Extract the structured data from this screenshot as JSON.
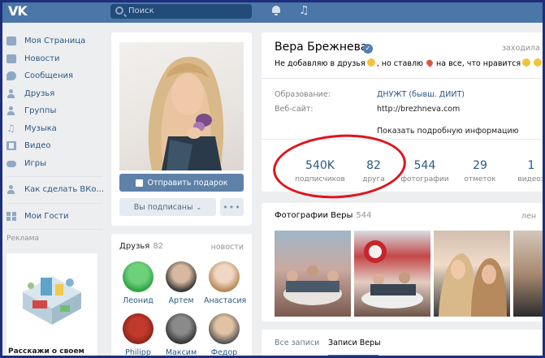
{
  "header": {
    "logo": "VK",
    "search_placeholder": "Поиск"
  },
  "menu": {
    "items": [
      {
        "label": "Моя Страница",
        "icon": "home-icon"
      },
      {
        "label": "Новости",
        "icon": "news-icon"
      },
      {
        "label": "Сообщения",
        "icon": "messages-icon"
      },
      {
        "label": "Друзья",
        "icon": "friends-icon"
      },
      {
        "label": "Группы",
        "icon": "groups-icon"
      },
      {
        "label": "Музыка",
        "icon": "music-icon"
      },
      {
        "label": "Видео",
        "icon": "video-icon"
      },
      {
        "label": "Игры",
        "icon": "games-icon"
      },
      {
        "label": "Как сделать ВКо...",
        "icon": "app-icon"
      },
      {
        "label": "Мои Гости",
        "icon": "guests-icon"
      }
    ],
    "ads_title": "Реклама",
    "ad_text": "Расскажи о своем"
  },
  "profile": {
    "gift_button": "Отправить подарок",
    "subscribed_button": "Вы подписаны",
    "more_button": "•••"
  },
  "friends": {
    "title": "Друзья",
    "count": "82",
    "new_label": "новости",
    "list": [
      {
        "name": "Леонид"
      },
      {
        "name": "Артем"
      },
      {
        "name": "Анастасия"
      },
      {
        "name": "Philipp"
      },
      {
        "name": "Максим"
      },
      {
        "name": "Федор"
      }
    ]
  },
  "info": {
    "name": "Вера Брежнева",
    "online": "заходила с",
    "status_part1": "Не добавляю в друзья",
    "status_part2": ", но ставлю",
    "status_part3": "на все, что нравится",
    "education_label": "Образование:",
    "education_value": "ДНУЖТ (бывш. ДИИТ)",
    "website_label": "Веб-сайт:",
    "website_value": "http://brezhneva.com",
    "more_info": "Показать подробную информацию",
    "stats": [
      {
        "value": "540K",
        "label": "подписчиков"
      },
      {
        "value": "82",
        "label": "друга"
      },
      {
        "value": "544",
        "label": "фотографии"
      },
      {
        "value": "29",
        "label": "отметок"
      },
      {
        "value": "1",
        "label": "видеоз"
      }
    ]
  },
  "photos": {
    "title": "Фотографии Веры",
    "count": "544",
    "more": "лен"
  },
  "posts": {
    "tab_all": "Все записи",
    "tab_own": "Записи Веры"
  }
}
